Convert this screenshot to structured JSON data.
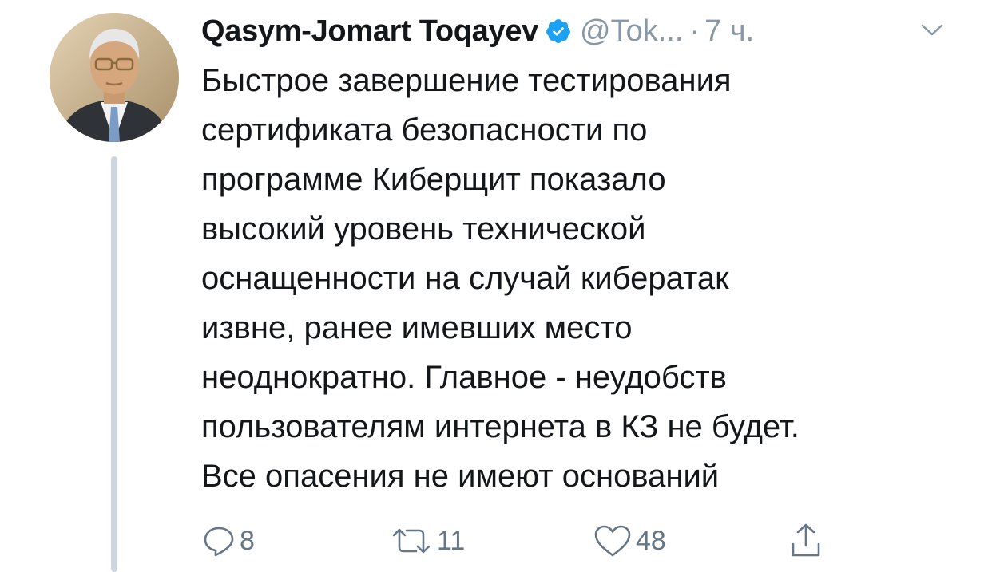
{
  "author": {
    "display_name": "Qasym-Jomart Toqayev",
    "handle": "@Tok...",
    "separator": "·",
    "time": "7 ч.",
    "verified": true
  },
  "tweet": {
    "lines": [
      "Быстрое завершение тестирования",
      "сертификата безопасности по",
      "программе Киберщит показало",
      "высокий уровень технической",
      "оснащенности на случай кибератак",
      "извне, ранее имевших место",
      "неоднократно. Главное - неудобств",
      "пользователям интернета в КЗ не будет.",
      "Все опасения не имеют оснований"
    ]
  },
  "actions": {
    "reply_count": "8",
    "retweet_count": "11",
    "like_count": "48"
  },
  "icons": {
    "verified": "verified-badge-icon",
    "menu": "chevron-down-icon",
    "reply": "reply-icon",
    "retweet": "retweet-icon",
    "like": "heart-icon",
    "share": "share-icon"
  },
  "colors": {
    "text": "#14171a",
    "muted": "#8899a6",
    "action": "#657786",
    "verified": "#1da1f2",
    "thread_line": "#cdd6dd",
    "background": "#ffffff"
  }
}
